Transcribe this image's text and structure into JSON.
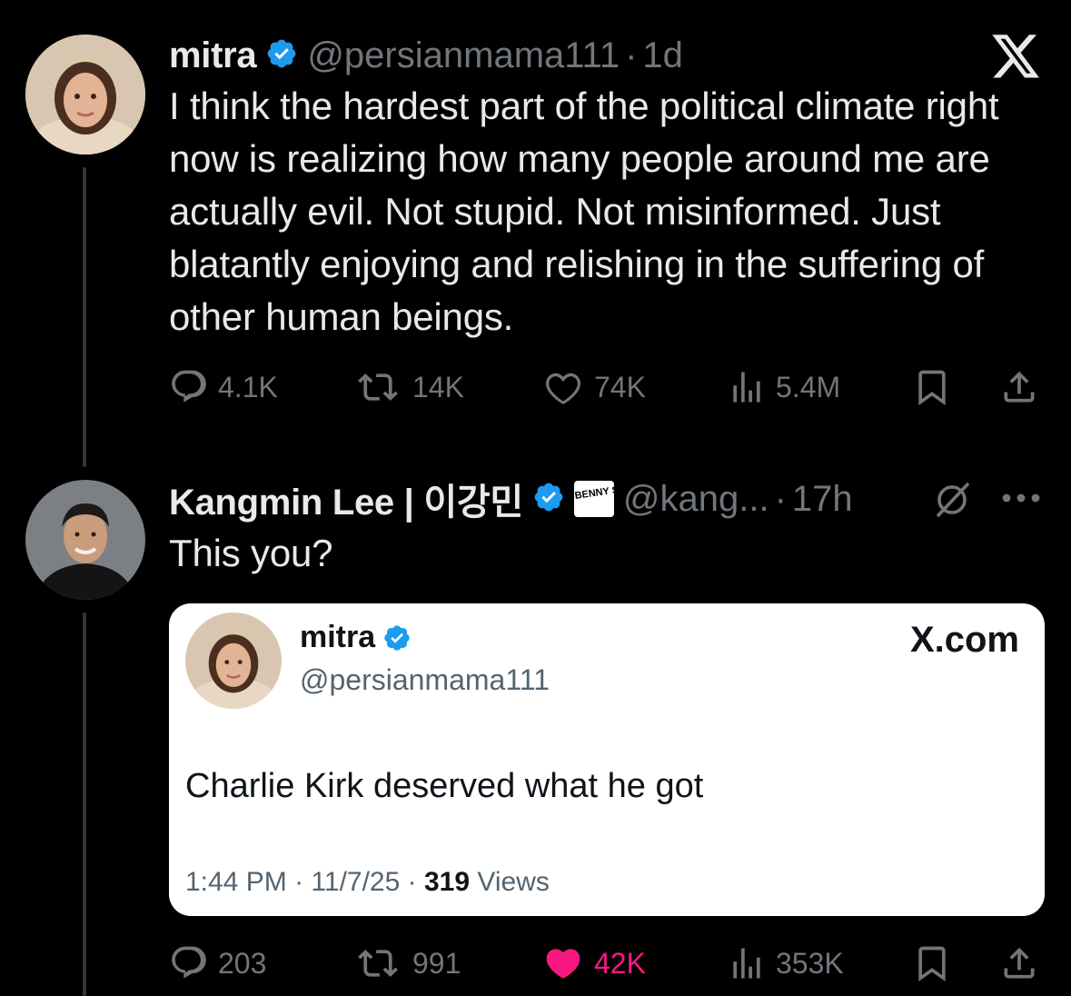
{
  "tweet1": {
    "name": "mitra",
    "handle": "@persianmama111",
    "separator": "·",
    "time": "1d",
    "text": "I think the hardest part of the political climate right now is realizing how many people around me are actually evil. Not stupid. Not misinformed. Just blatantly enjoying and relishing in the suffering of other human beings.",
    "actions": {
      "replies": "4.1K",
      "reposts": "14K",
      "likes": "74K",
      "views": "5.4M"
    }
  },
  "brand_icon": "x-logo-icon",
  "tweet2": {
    "name": "Kangmin Lee | 이강민",
    "badge_text": "BENNY SHOW",
    "handle": "@kang...",
    "separator": "·",
    "time": "17h",
    "text": "This you?",
    "actions": {
      "replies": "203",
      "reposts": "991",
      "likes": "42K",
      "views": "353K"
    }
  },
  "embedded": {
    "name": "mitra",
    "handle": "@persianmama111",
    "site": "X.com",
    "text": "Charlie Kirk deserved what he got",
    "time": "1:44 PM",
    "date": "11/7/25",
    "views_count": "319",
    "views_label": "Views",
    "separator": "·"
  },
  "colors": {
    "background": "#000000",
    "text": "#e7e9ea",
    "muted": "#71767b",
    "verified": "#1d9bf0",
    "like_active": "#f91880"
  }
}
